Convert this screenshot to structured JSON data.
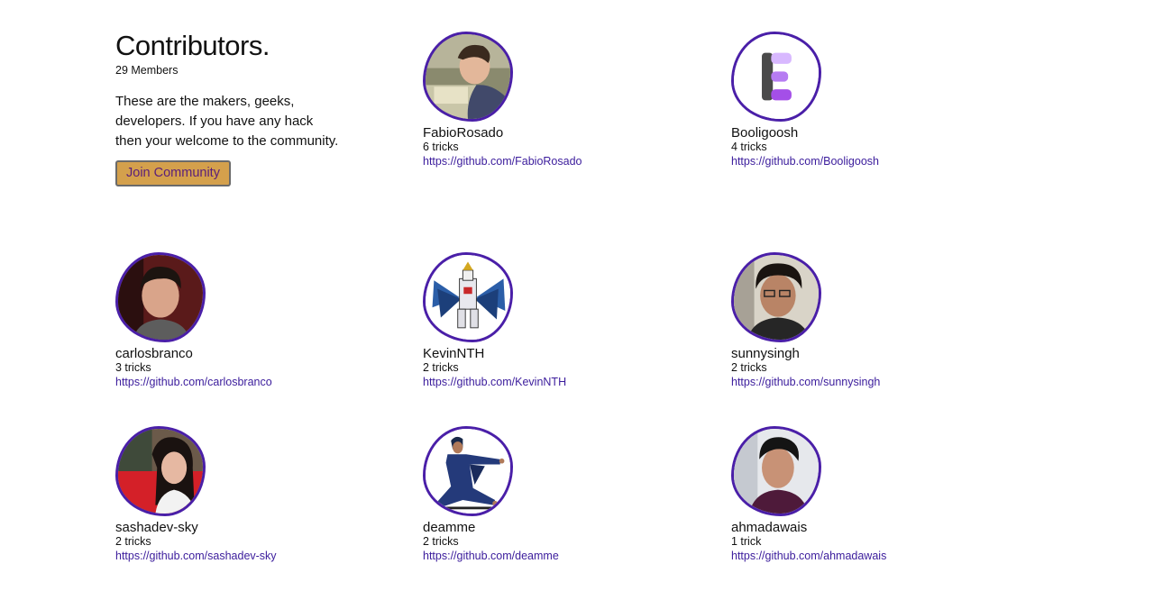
{
  "intro": {
    "title": "Contributors.",
    "members": "29 Members",
    "description": "These are the makers, geeks, developers. If you have any hack then your welcome to the community.",
    "join_label": "Join Community"
  },
  "colors": {
    "avatar_border": "#4a1fa8",
    "link": "#3b1c9c",
    "button_bg": "#d4a04c",
    "button_text": "#5a1f7a"
  },
  "contributors": [
    {
      "name": "FabioRosado",
      "tricks": "6 tricks",
      "url": "https://github.com/FabioRosado",
      "avatar": "photo-avatar-icon"
    },
    {
      "name": "Booligoosh",
      "tricks": "4 tricks",
      "url": "https://github.com/Booligoosh",
      "avatar": "letter-e-logo-icon"
    },
    {
      "name": "carlosbranco",
      "tricks": "3 tricks",
      "url": "https://github.com/carlosbranco",
      "avatar": "photo-avatar-icon"
    },
    {
      "name": "KevinNTH",
      "tricks": "2 tricks",
      "url": "https://github.com/KevinNTH",
      "avatar": "robot-illustration-icon"
    },
    {
      "name": "sunnysingh",
      "tricks": "2 tricks",
      "url": "https://github.com/sunnysingh",
      "avatar": "photo-avatar-icon"
    },
    {
      "name": "sashadev-sky",
      "tricks": "2 tricks",
      "url": "https://github.com/sashadev-sky",
      "avatar": "photo-avatar-icon"
    },
    {
      "name": "deamme",
      "tricks": "2 tricks",
      "url": "https://github.com/deamme",
      "avatar": "person-illustration-icon"
    },
    {
      "name": "ahmadawais",
      "tricks": "1 trick",
      "url": "https://github.com/ahmadawais",
      "avatar": "photo-avatar-icon"
    }
  ]
}
